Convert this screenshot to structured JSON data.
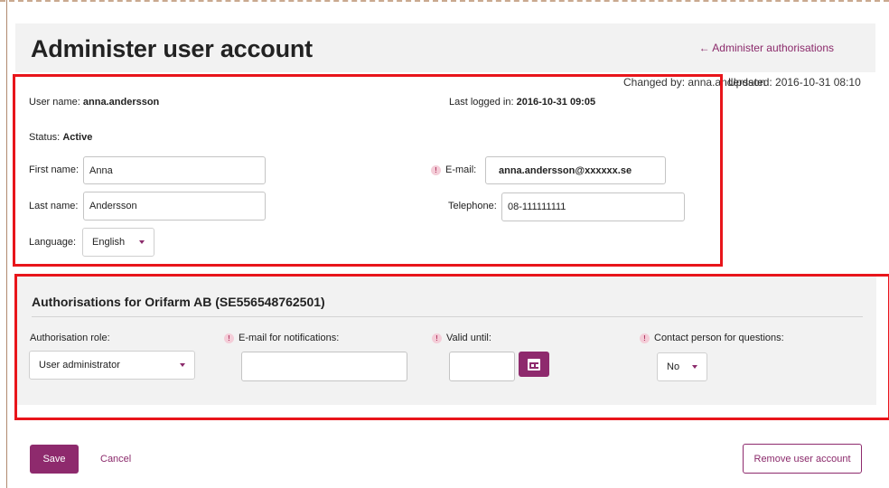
{
  "header": {
    "title": "Administer user account",
    "admin_link": "← Administer authorisations"
  },
  "meta": {
    "changed_by": "Changed by: anna.andersson",
    "updated": "Updated: 2016-10-31 08:10"
  },
  "account": {
    "username_label": "User name:",
    "username": "anna.andersson",
    "last_logged_label": "Last logged in:",
    "last_logged": "2016-10-31 09:05",
    "status_label": "Status:",
    "status": "Active",
    "first_name_label": "First name:",
    "first_name": "Anna",
    "last_name_label": "Last name:",
    "last_name": "Andersson",
    "email_label": "E-mail:",
    "email": "anna.andersson@xxxxxx.se",
    "telephone_label": "Telephone:",
    "telephone": "08-111111111",
    "language_label": "Language:",
    "language": "English"
  },
  "authorisations": {
    "title": "Authorisations for Orifarm AB (SE556548762501)",
    "role_label": "Authorisation role:",
    "role_value": "User administrator",
    "notif_label": "E-mail for notifications:",
    "notif_value": "",
    "valid_label": "Valid until:",
    "valid_value": "",
    "contact_label": "Contact person for questions:",
    "contact_value": "No",
    "required_marker": "!"
  },
  "actions": {
    "save": "Save",
    "cancel": "Cancel",
    "remove": "Remove user account"
  },
  "colors": {
    "accent": "#8e2a6d",
    "highlight_box": "#e8151b",
    "panel_bg": "#f2f2f2"
  },
  "icons": {
    "calendar": "calendar-icon",
    "dropdown": "chevron-down-icon",
    "required": "required-info-icon"
  }
}
